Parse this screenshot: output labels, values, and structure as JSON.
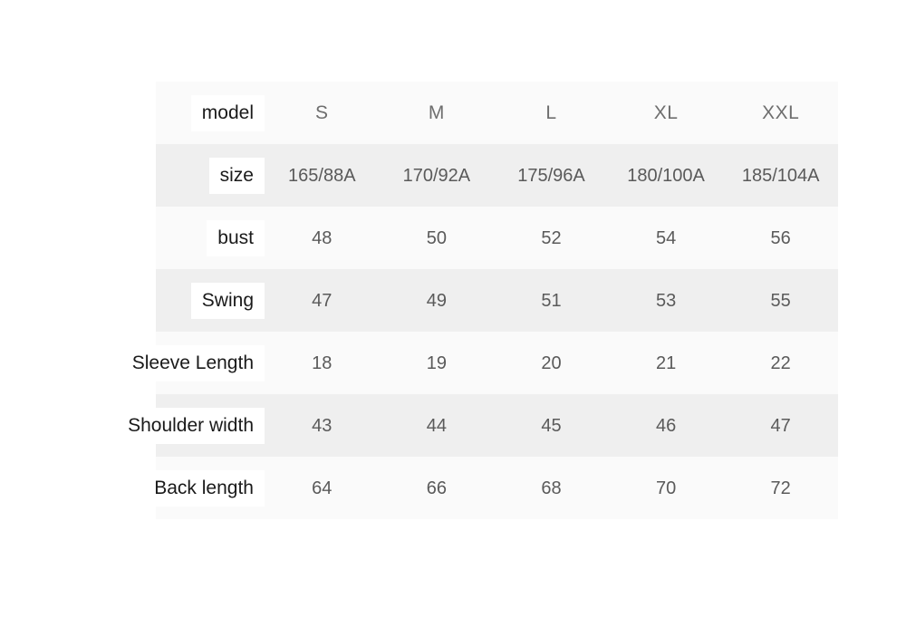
{
  "chart_data": {
    "type": "table",
    "title": "",
    "row_header_label": "model",
    "categories": [
      "S",
      "M",
      "L",
      "XL",
      "XXL"
    ],
    "rows": [
      {
        "label": "model",
        "values": [
          "S",
          "M",
          "L",
          "XL",
          "XXL"
        ]
      },
      {
        "label": "size",
        "values": [
          "165/88A",
          "170/92A",
          "175/96A",
          "180/100A",
          "185/104A"
        ]
      },
      {
        "label": "bust",
        "values": [
          "48",
          "50",
          "52",
          "54",
          "56"
        ]
      },
      {
        "label": "Swing",
        "values": [
          "47",
          "49",
          "51",
          "53",
          "55"
        ]
      },
      {
        "label": "Sleeve Length",
        "values": [
          "18",
          "19",
          "20",
          "21",
          "22"
        ]
      },
      {
        "label": "Shoulder width",
        "values": [
          "43",
          "44",
          "45",
          "46",
          "47"
        ]
      },
      {
        "label": "Back length",
        "values": [
          "64",
          "66",
          "68",
          "70",
          "72"
        ]
      }
    ],
    "colors": {
      "row_light": "#fafafa",
      "row_shade": "#efefef",
      "label_text": "#1a1a1a",
      "value_text": "#5a5a5a",
      "label_chip_background": "#ffffff",
      "page_background": "#ffffff"
    }
  }
}
